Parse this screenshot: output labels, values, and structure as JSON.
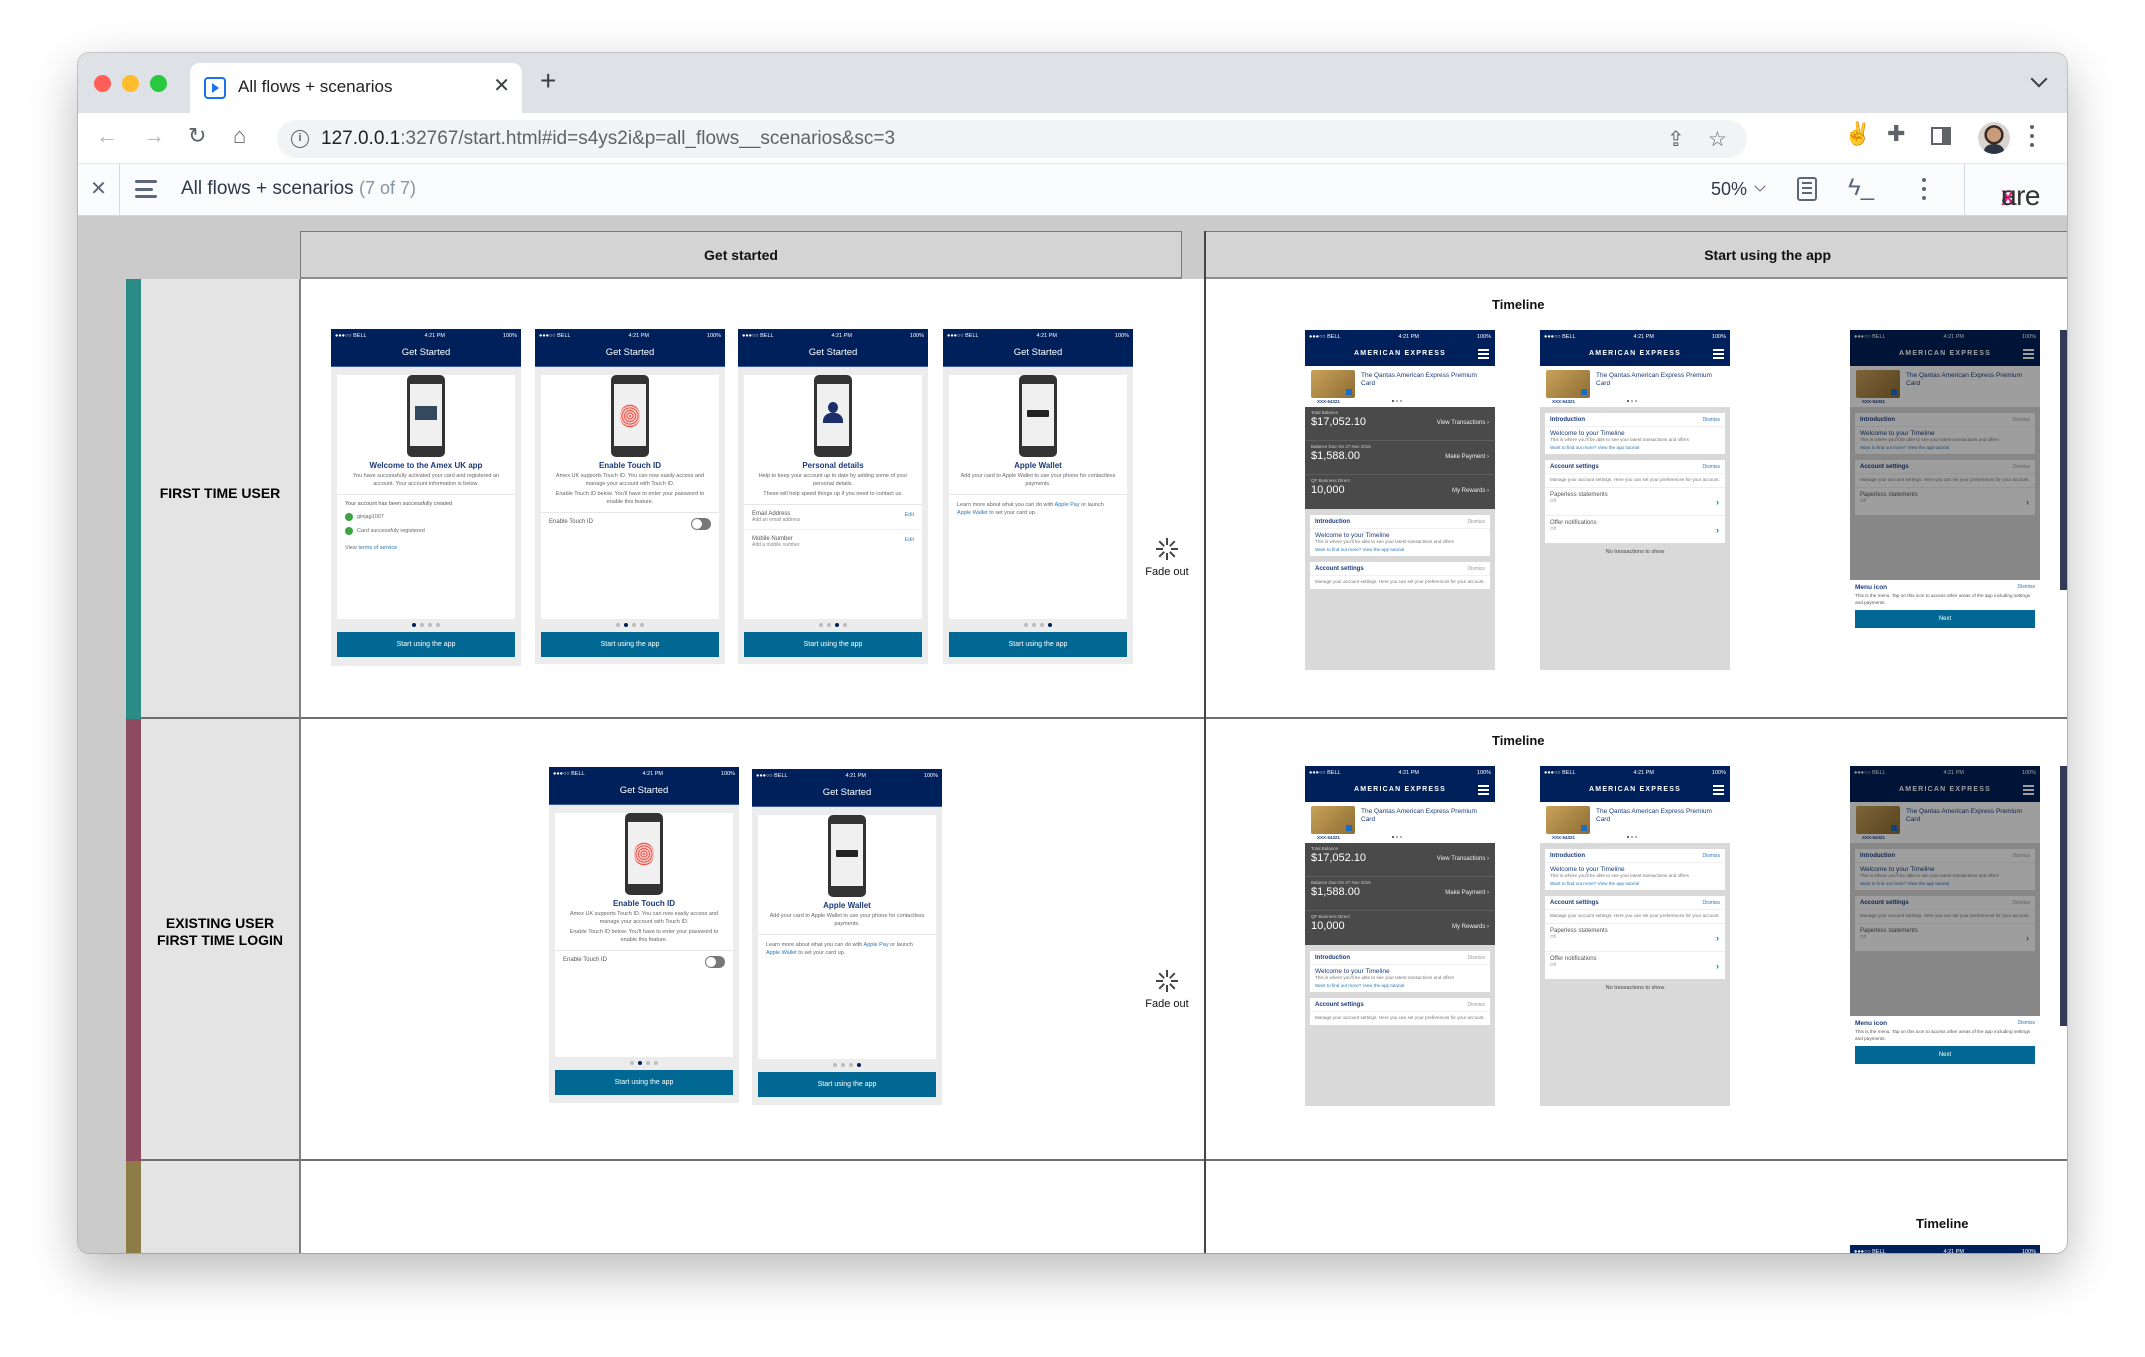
{
  "browser": {
    "tab_title": "All flows + scenarios",
    "url_host": "127.0.0.1",
    "url_rest": ":32767/start.html#id=s4ys2i&p=all_flows__scenarios&sc=3",
    "traffic_colors": {
      "close": "#ff5f57",
      "minimize": "#febc2e",
      "maximize": "#28c840"
    }
  },
  "axure": {
    "page_title": "All flows + scenarios",
    "page_count": "(7 of 7)",
    "zoom": "50%",
    "logo_a": "a",
    "logo_x": "x",
    "logo_rest": "ure"
  },
  "grid": {
    "columns": [
      {
        "label": "Get started"
      },
      {
        "label": "Start using the app"
      }
    ],
    "rows": [
      {
        "label": "FIRST TIME USER",
        "color": "#2a8c84"
      },
      {
        "label": "EXISTING USER\nFIRST TIME LOGIN",
        "color": "#8d4a60"
      },
      {
        "label": "",
        "color": "#8c7d48"
      }
    ],
    "transition_label": "Fade out",
    "timeline_label": "Timeline"
  },
  "phone_common": {
    "carrier": "●●●○○ BELL",
    "time": "4:21 PM",
    "battery": "100%",
    "header": "Get Started",
    "cta": "Start using the app"
  },
  "onboarding": {
    "welcome": {
      "heading": "Welcome to the Amex UK app",
      "body": "You have successfully activated your card and registered an account. Your account information is below.",
      "status": "Your account has been successfully created",
      "check1": "ginjag1007",
      "check2": "Card successfuly registered",
      "terms_prefix": "View ",
      "terms_link": "terms of service"
    },
    "touchid": {
      "heading": "Enable Touch ID",
      "body1": "Amex UK supports Touch ID. You can now easily access and manage your account with Touch ID.",
      "body2": "Enable Touch ID below. You'll have to enter your password to enable this feature.",
      "toggle_label": "Enable Touch ID",
      "toggle_on": false
    },
    "personal": {
      "heading": "Personal details",
      "body1": "Help to keep your account up to date by adding some of your personal details.",
      "body2": "These will help speed things up if you need to contact us.",
      "email_label": "Email Address",
      "email_sub": "Add an email address",
      "mobile_label": "Mobile Number",
      "mobile_sub": "Add a mobile number",
      "edit": "Edit"
    },
    "wallet": {
      "heading": "Apple Wallet",
      "body": "Add your card to Apple Wallet to use your phone for contactless payments.",
      "learn_1": "Learn more about what you can do with ",
      "learn_link1": "Apple Pay",
      "learn_2": " or launch ",
      "learn_link2": "Apple Wallet",
      "learn_3": " to set your card up."
    }
  },
  "timeline": {
    "brand": "AMERICAN EXPRESS",
    "card_name": "The Qantas American Express Premium Card",
    "card_number": "XXX-54321",
    "balances": [
      {
        "label": "Total Balance",
        "value": "$17,052.10",
        "link": "View Transactions"
      },
      {
        "label": "Balance Due On 27 Nov 2015",
        "value": "$1,588.00",
        "link": "Make Payment"
      },
      {
        "label": "QF Business Direct",
        "value": "10,000",
        "link": "My Rewards"
      }
    ],
    "intro_title": "Introduction",
    "dismiss": "Dismiss",
    "intro_heading": "Welcome to your Timeline",
    "intro_body": "This is where you'll be able to see your latest transactions and offers",
    "intro_link": "Want to find out more? View the app tutorial",
    "settings_title": "Account settings",
    "settings_body": "Manage your account settings. Here you can set your preferences for your account.",
    "paperless": "Paperless statements",
    "paperless_state": "Off",
    "offers": "Offer notifications",
    "offers_state": "Off",
    "no_tx": "No transactions to show",
    "tip_title": "Menu icon",
    "tip_body": "This is the menu. Tap on this icon to access other areas of the app including settings and payments.",
    "tip_button": "Next"
  }
}
